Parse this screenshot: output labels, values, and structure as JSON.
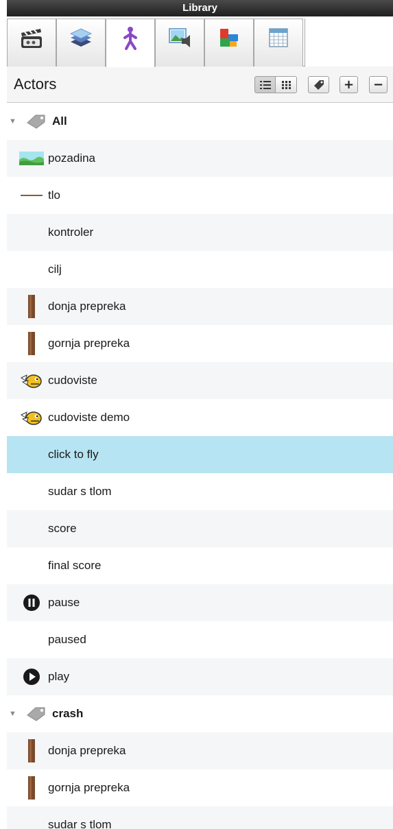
{
  "window": {
    "title": "Library"
  },
  "tabs": [
    {
      "name": "tab-game-settings",
      "icon": "clapperboard-icon",
      "active": false
    },
    {
      "name": "tab-layers",
      "icon": "layers-icon",
      "active": false
    },
    {
      "name": "tab-actors",
      "icon": "actor-figure-icon",
      "active": true
    },
    {
      "name": "tab-images",
      "icon": "image-sound-icon",
      "active": false
    },
    {
      "name": "tab-tiles",
      "icon": "tiles-icon",
      "active": false
    },
    {
      "name": "tab-table",
      "icon": "table-icon",
      "active": false
    }
  ],
  "header": {
    "title": "Actors",
    "buttons": [
      "list-view",
      "grid-view",
      "tag",
      "add",
      "remove"
    ],
    "add_label": "+",
    "remove_label": "−"
  },
  "colors": {
    "selected_row": "#b7e4f2",
    "alt_row": "#f4f6f8",
    "titlebar": "#2a2a2a"
  },
  "list": {
    "rows": [
      {
        "label": "All",
        "type": "group",
        "icon": "tag-icon"
      },
      {
        "label": "pozadina",
        "type": "item",
        "icon": "background-thumbnail-icon"
      },
      {
        "label": "tlo",
        "type": "item",
        "icon": "ground-line-icon"
      },
      {
        "label": "kontroler",
        "type": "item",
        "icon": ""
      },
      {
        "label": "cilj",
        "type": "item",
        "icon": ""
      },
      {
        "label": "donja prepreka",
        "type": "item",
        "icon": "pipe-icon"
      },
      {
        "label": "gornja prepreka",
        "type": "item",
        "icon": "pipe-icon"
      },
      {
        "label": "cudoviste",
        "type": "item",
        "icon": "monster-icon"
      },
      {
        "label": "cudoviste demo",
        "type": "item",
        "icon": "monster-icon"
      },
      {
        "label": "click to fly",
        "type": "item",
        "icon": "",
        "selected": true
      },
      {
        "label": "sudar s tlom",
        "type": "item",
        "icon": ""
      },
      {
        "label": "score",
        "type": "item",
        "icon": ""
      },
      {
        "label": "final score",
        "type": "item",
        "icon": ""
      },
      {
        "label": "pause",
        "type": "item",
        "icon": "pause-icon"
      },
      {
        "label": "paused",
        "type": "item",
        "icon": ""
      },
      {
        "label": "play",
        "type": "item",
        "icon": "play-icon"
      },
      {
        "label": "crash",
        "type": "group",
        "icon": "tag-icon"
      },
      {
        "label": "donja prepreka",
        "type": "item",
        "icon": "pipe-icon"
      },
      {
        "label": "gornja prepreka",
        "type": "item",
        "icon": "pipe-icon"
      },
      {
        "label": "sudar s tlom",
        "type": "item",
        "icon": ""
      }
    ]
  }
}
